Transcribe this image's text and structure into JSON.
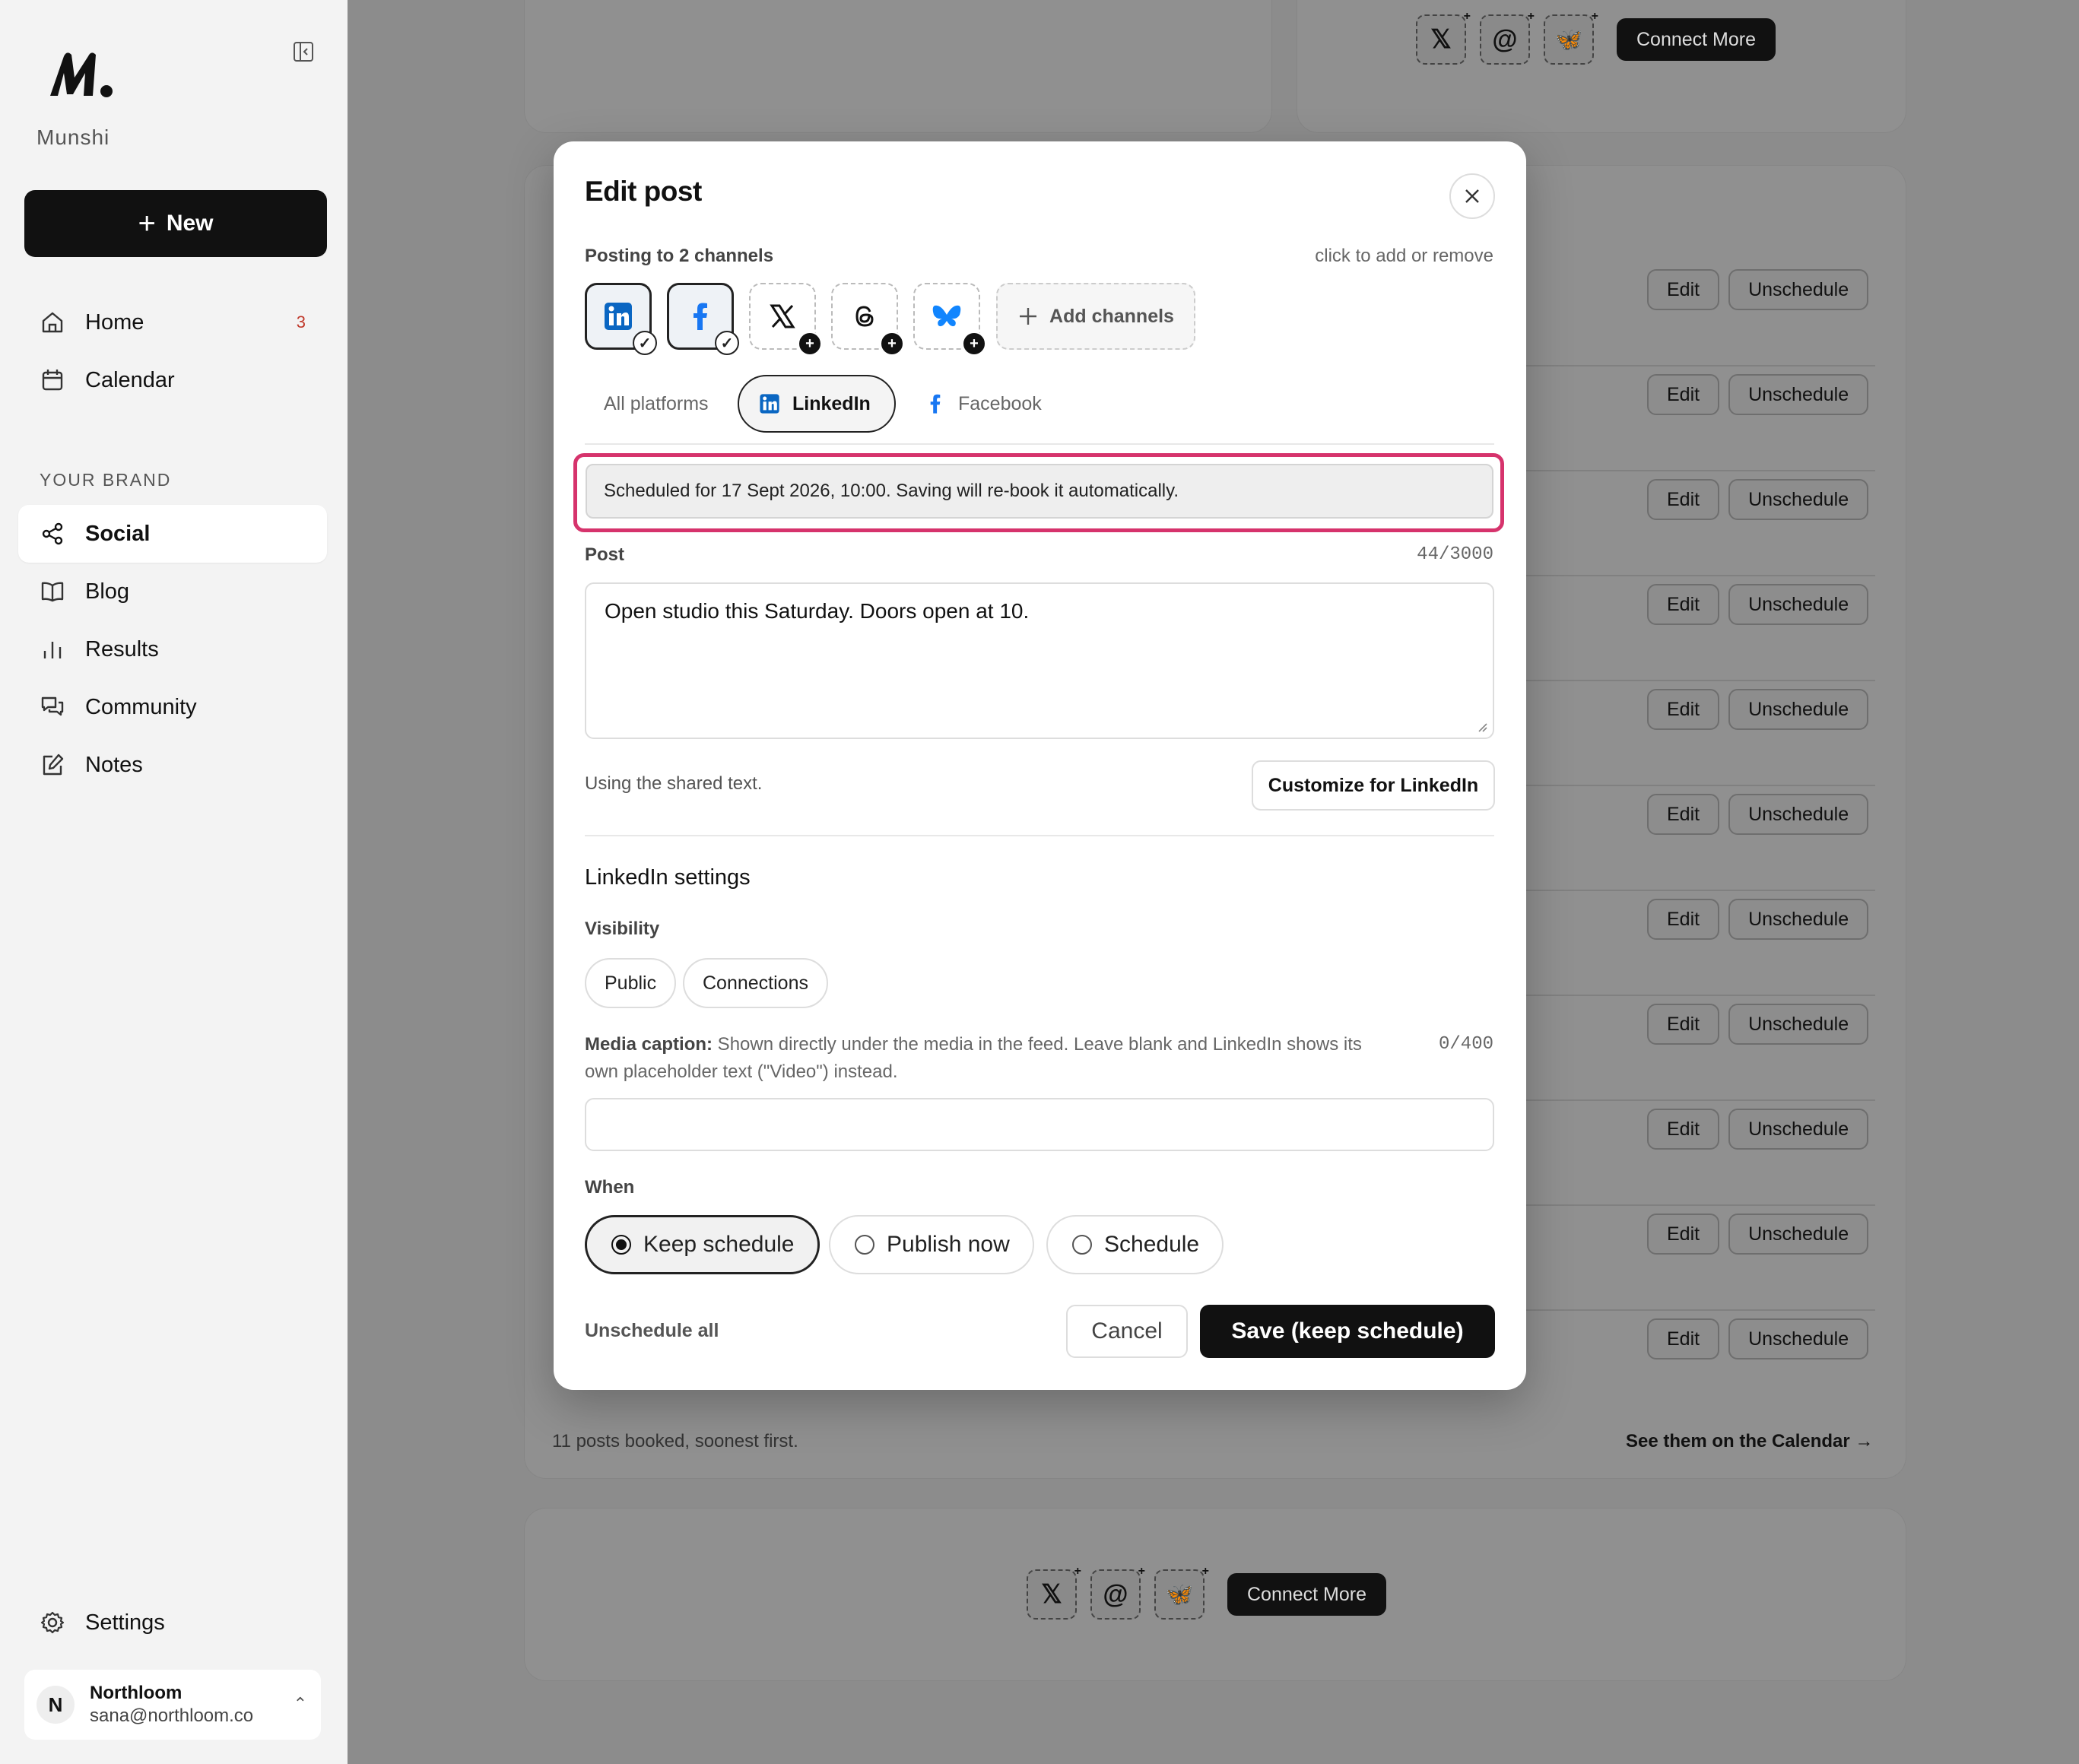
{
  "sidebar": {
    "brand": "Munshi",
    "new_label": "New",
    "nav": [
      {
        "label": "Home",
        "icon": "home-icon",
        "badge": "3"
      },
      {
        "label": "Calendar",
        "icon": "calendar-icon"
      }
    ],
    "section_label": "YOUR BRAND",
    "brand_nav": [
      {
        "label": "Social",
        "icon": "share-icon",
        "active": true
      },
      {
        "label": "Blog",
        "icon": "book-icon"
      },
      {
        "label": "Results",
        "icon": "bar-chart-icon"
      },
      {
        "label": "Community",
        "icon": "chat-icon"
      },
      {
        "label": "Notes",
        "icon": "edit-note-icon"
      }
    ],
    "settings_label": "Settings",
    "account": {
      "initial": "N",
      "name": "Northloom",
      "email": "sana@northloom.co"
    }
  },
  "background": {
    "edit_label": "Edit",
    "unschedule_label": "Unschedule",
    "connect_more_label": "Connect More",
    "footer_count": "11 posts booked, soonest first.",
    "footer_link": "See them on the Calendar →"
  },
  "modal": {
    "title": "Edit post",
    "posting_to": "Posting to 2 channels",
    "channel_hint": "click to add or remove",
    "channels": [
      {
        "name": "linkedin",
        "selected": true
      },
      {
        "name": "facebook",
        "selected": true
      },
      {
        "name": "x",
        "selected": false
      },
      {
        "name": "threads",
        "selected": false
      },
      {
        "name": "bluesky",
        "selected": false
      }
    ],
    "add_channels_label": "Add channels",
    "tabs": {
      "all": "All platforms",
      "linkedin": "LinkedIn",
      "facebook": "Facebook"
    },
    "schedule_notice": "Scheduled for 17 Sept 2026, 10:00. Saving will re-book it automatically.",
    "post_label": "Post",
    "post_count": "44/3000",
    "post_text": "Open studio this Saturday. Doors open at 10.",
    "shared_text_note": "Using the shared text.",
    "customize_label": "Customize for LinkedIn",
    "settings_heading": "LinkedIn settings",
    "visibility_label": "Visibility",
    "visibility_options": [
      "Public",
      "Connections"
    ],
    "caption_label": "Media caption:",
    "caption_help": " Shown directly under the media in the feed. Leave blank and LinkedIn shows its own placeholder text (\"Video\") instead.",
    "caption_count": "0/400",
    "caption_value": "",
    "when_label": "When",
    "when_options": [
      "Keep schedule",
      "Publish now",
      "Schedule"
    ],
    "when_selected": "Keep schedule",
    "unschedule_all_label": "Unschedule all",
    "cancel_label": "Cancel",
    "save_label": "Save (keep schedule)"
  },
  "colors": {
    "accent": "#111111",
    "highlight": "#d6336c",
    "linkedin": "#0a66c2",
    "facebook": "#1877f2",
    "bluesky": "#1185fe",
    "badge": "#c0392b"
  }
}
